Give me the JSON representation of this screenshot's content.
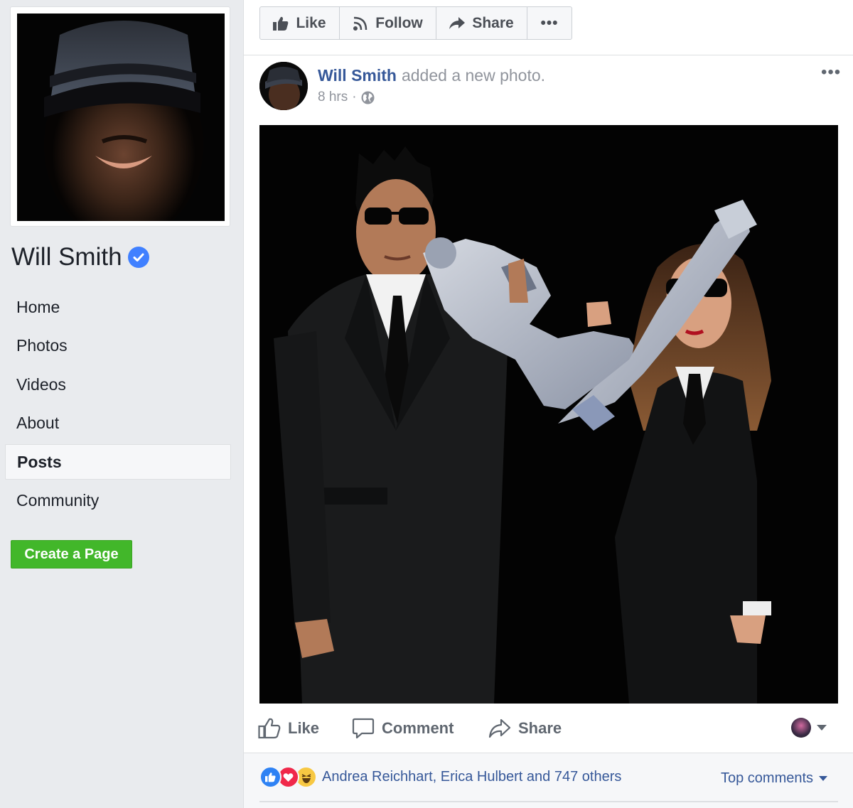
{
  "page": {
    "name": "Will Smith",
    "verified": true,
    "create_page_label": "Create a Page"
  },
  "sidebar": {
    "items": [
      {
        "label": "Home"
      },
      {
        "label": "Photos"
      },
      {
        "label": "Videos"
      },
      {
        "label": "About"
      },
      {
        "label": "Posts",
        "active": true
      },
      {
        "label": "Community"
      }
    ]
  },
  "actionbar": {
    "like": "Like",
    "follow": "Follow",
    "share": "Share",
    "more": "•••"
  },
  "post": {
    "author": "Will Smith",
    "action": "added a new photo.",
    "time": "8 hrs",
    "separator": "·",
    "privacy_icon": "globe-icon",
    "menu": "•••",
    "buttons": {
      "like": "Like",
      "comment": "Comment",
      "share": "Share"
    },
    "reactions": {
      "icons": [
        "like-reaction-icon",
        "love-reaction-icon",
        "haha-reaction-icon"
      ],
      "summary": "Andrea Reichhart, Erica Hulbert and 747 others"
    },
    "comments_filter": "Top comments"
  },
  "colors": {
    "background": "#e9ebee",
    "link": "#365899",
    "create_button": "#42b72a",
    "verified_badge": "#4080ff"
  }
}
